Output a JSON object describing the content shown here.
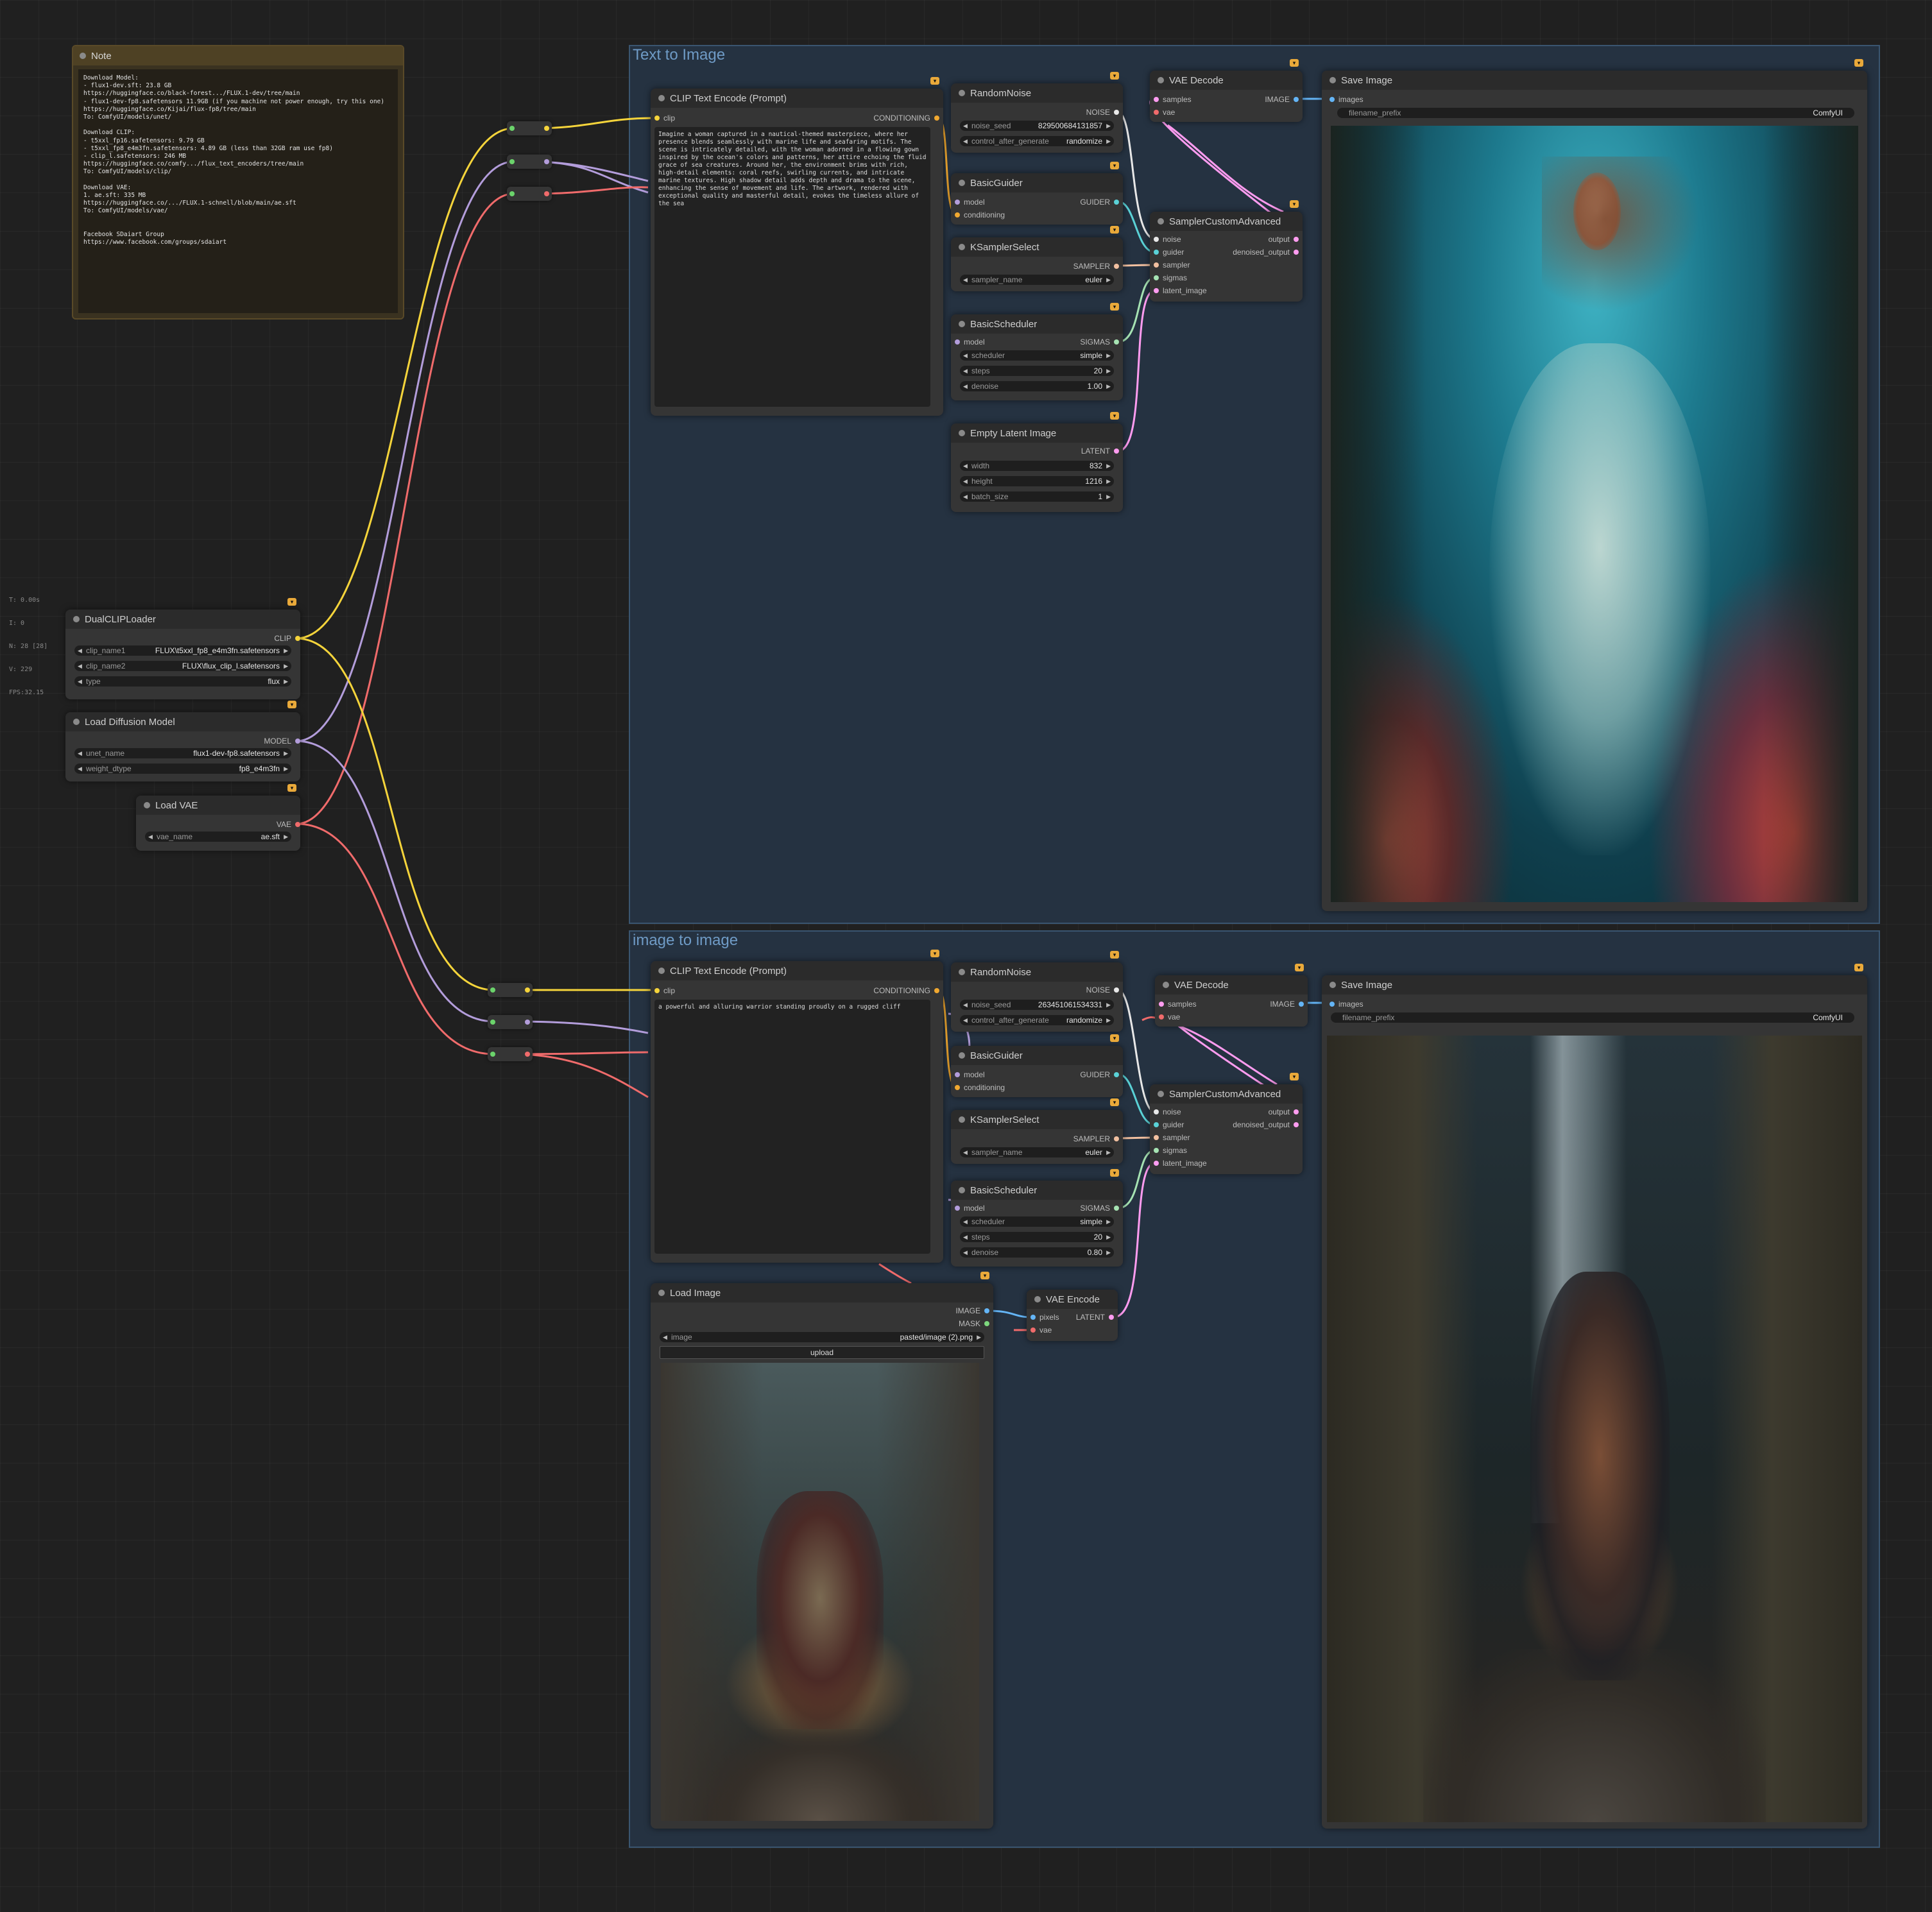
{
  "stats": {
    "lines": [
      "T: 0.00s",
      "I: 0",
      "N: 28 [28]",
      "V: 229",
      "FPS:32.15"
    ]
  },
  "note": {
    "title": "Note",
    "text": "Download Model:\n- flux1-dev.sft: 23.8 GB\nhttps://huggingface.co/black-forest.../FLUX.1-dev/tree/main\n- flux1-dev-fp8.safetensors 11.9GB (if you machine not power enough, try this one)\nhttps://huggingface.co/Kijai/flux-fp8/tree/main\nTo: ComfyUI/models/unet/\n\nDownload CLIP:\n- t5xxl_fp16.safetensors: 9.79 GB\n- t5xxl_fp8_e4m3fn.safetensors: 4.89 GB (less than 32GB ram use fp8)\n- clip_l.safetensors: 246 MB\nhttps://huggingface.co/comfy.../flux_text_encoders/tree/main\nTo: ComfyUI/models/clip/\n\nDownload VAE:\n1. ae.sft: 335 MB\nhttps://huggingface.co/.../FLUX.1-schnell/blob/main/ae.sft\nTo: ComfyUI/models/vae/\n\n\nFacebook SDaiart Group\nhttps://www.facebook.com/groups/sdaiart"
  },
  "colors": {
    "clip": "#f5d43b",
    "model": "#b39ddb",
    "vae": "#f06b6b",
    "conditioning": "#f0a830",
    "noise": "#e8e8e8",
    "guider": "#5ad1d6",
    "sampler": "#f2c0a0",
    "sigmas": "#a6e3b3",
    "latent": "#ff9cf0",
    "image": "#64b5f6",
    "mask": "#7ed87e"
  },
  "loaders": {
    "dualclip": {
      "title": "DualCLIPLoader",
      "out": "CLIP",
      "w1_label": "clip_name1",
      "w1_value": "FLUX\\t5xxl_fp8_e4m3fn.safetensors",
      "w2_label": "clip_name2",
      "w2_value": "FLUX\\flux_clip_l.safetensors",
      "w3_label": "type",
      "w3_value": "flux"
    },
    "diffusion": {
      "title": "Load Diffusion Model",
      "out": "MODEL",
      "w1_label": "unet_name",
      "w1_value": "flux1-dev-fp8.safetensors",
      "w2_label": "weight_dtype",
      "w2_value": "fp8_e4m3fn"
    },
    "vae": {
      "title": "Load VAE",
      "out": "VAE",
      "w1_label": "vae_name",
      "w1_value": "ae.sft"
    }
  },
  "groups": {
    "t2i": {
      "title": "Text to Image",
      "clip": {
        "title": "CLIP Text Encode (Prompt)",
        "in": "clip",
        "out": "CONDITIONING",
        "text": "Imagine a woman captured in a nautical-themed masterpiece, where her presence blends seamlessly with marine life and seafaring motifs. The scene is intricately detailed, with the woman adorned in a flowing gown inspired by the ocean's colors and patterns, her attire echoing the fluid grace of sea creatures. Around her, the environment brims with rich, high-detail elements: coral reefs, swirling currents, and intricate marine textures. High shadow detail adds depth and drama to the scene, enhancing the sense of movement and life. The artwork, rendered with exceptional quality and masterful detail, evokes the timeless allure of the sea"
      },
      "noise": {
        "title": "RandomNoise",
        "out": "NOISE",
        "w1_label": "noise_seed",
        "w1_value": "829500684131857",
        "w2_label": "control_after_generate",
        "w2_value": "randomize"
      },
      "guider": {
        "title": "BasicGuider",
        "in1": "model",
        "in2": "conditioning",
        "out": "GUIDER"
      },
      "ksampler": {
        "title": "KSamplerSelect",
        "out": "SAMPLER",
        "w1_label": "sampler_name",
        "w1_value": "euler"
      },
      "scheduler": {
        "title": "BasicScheduler",
        "in1": "model",
        "out": "SIGMAS",
        "w1_label": "scheduler",
        "w1_value": "simple",
        "w2_label": "steps",
        "w2_value": "20",
        "w3_label": "denoise",
        "w3_value": "1.00"
      },
      "latent": {
        "title": "Empty Latent Image",
        "out": "LATENT",
        "w1_label": "width",
        "w1_value": "832",
        "w2_label": "height",
        "w2_value": "1216",
        "w3_label": "batch_size",
        "w3_value": "1"
      },
      "vaedecode": {
        "title": "VAE Decode",
        "in1": "samples",
        "in2": "vae",
        "out": "IMAGE"
      },
      "sampler": {
        "title": "SamplerCustomAdvanced",
        "in1": "noise",
        "in2": "guider",
        "in3": "sampler",
        "in4": "sigmas",
        "in5": "latent_image",
        "out1": "output",
        "out2": "denoised_output"
      },
      "save": {
        "title": "Save Image",
        "in1": "images",
        "w1_label": "filename_prefix",
        "w1_value": "ComfyUI"
      }
    },
    "i2i": {
      "title": "image to image",
      "clip": {
        "title": "CLIP Text Encode (Prompt)",
        "in": "clip",
        "out": "CONDITIONING",
        "text": "a powerful and alluring warrior standing proudly on a rugged cliff"
      },
      "noise": {
        "title": "RandomNoise",
        "out": "NOISE",
        "w1_label": "noise_seed",
        "w1_value": "263451061534331",
        "w2_label": "control_after_generate",
        "w2_value": "randomize"
      },
      "guider": {
        "title": "BasicGuider",
        "in1": "model",
        "in2": "conditioning",
        "out": "GUIDER"
      },
      "ksampler": {
        "title": "KSamplerSelect",
        "out": "SAMPLER",
        "w1_label": "sampler_name",
        "w1_value": "euler"
      },
      "scheduler": {
        "title": "BasicScheduler",
        "in1": "model",
        "out": "SIGMAS",
        "w1_label": "scheduler",
        "w1_value": "simple",
        "w2_label": "steps",
        "w2_value": "20",
        "w3_label": "denoise",
        "w3_value": "0.80"
      },
      "vaedecode": {
        "title": "VAE Decode",
        "in1": "samples",
        "in2": "vae",
        "out": "IMAGE"
      },
      "sampler": {
        "title": "SamplerCustomAdvanced",
        "in1": "noise",
        "in2": "guider",
        "in3": "sampler",
        "in4": "sigmas",
        "in5": "latent_image",
        "out1": "output",
        "out2": "denoised_output"
      },
      "save": {
        "title": "Save Image",
        "in1": "images",
        "w1_label": "filename_prefix",
        "w1_value": "ComfyUI"
      },
      "loadimage": {
        "title": "Load Image",
        "out1": "IMAGE",
        "out2": "MASK",
        "w1_label": "image",
        "w1_value": "pasted/image (2).png",
        "upload": "upload"
      },
      "vaeencode": {
        "title": "VAE Encode",
        "in1": "pixels",
        "in2": "vae",
        "out": "LATENT"
      }
    }
  },
  "icons": {
    "node_badge": "fox-badge-icon",
    "arrow_left": "◀",
    "arrow_right": "▶"
  }
}
